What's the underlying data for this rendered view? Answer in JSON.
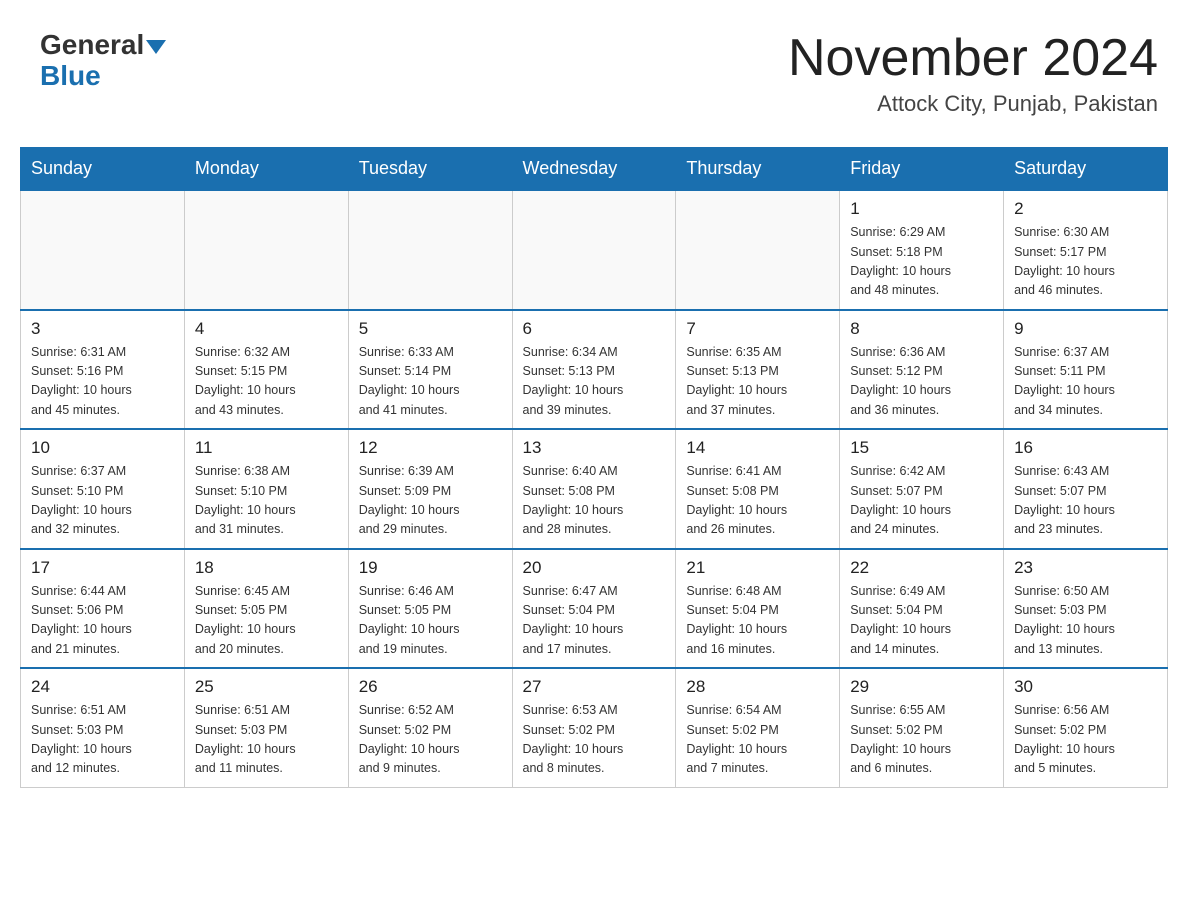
{
  "header": {
    "logo_line1": "General",
    "logo_line2": "Blue",
    "month_title": "November 2024",
    "location": "Attock City, Punjab, Pakistan"
  },
  "weekdays": [
    "Sunday",
    "Monday",
    "Tuesday",
    "Wednesday",
    "Thursday",
    "Friday",
    "Saturday"
  ],
  "weeks": [
    [
      {
        "day": "",
        "info": ""
      },
      {
        "day": "",
        "info": ""
      },
      {
        "day": "",
        "info": ""
      },
      {
        "day": "",
        "info": ""
      },
      {
        "day": "",
        "info": ""
      },
      {
        "day": "1",
        "info": "Sunrise: 6:29 AM\nSunset: 5:18 PM\nDaylight: 10 hours\nand 48 minutes."
      },
      {
        "day": "2",
        "info": "Sunrise: 6:30 AM\nSunset: 5:17 PM\nDaylight: 10 hours\nand 46 minutes."
      }
    ],
    [
      {
        "day": "3",
        "info": "Sunrise: 6:31 AM\nSunset: 5:16 PM\nDaylight: 10 hours\nand 45 minutes."
      },
      {
        "day": "4",
        "info": "Sunrise: 6:32 AM\nSunset: 5:15 PM\nDaylight: 10 hours\nand 43 minutes."
      },
      {
        "day": "5",
        "info": "Sunrise: 6:33 AM\nSunset: 5:14 PM\nDaylight: 10 hours\nand 41 minutes."
      },
      {
        "day": "6",
        "info": "Sunrise: 6:34 AM\nSunset: 5:13 PM\nDaylight: 10 hours\nand 39 minutes."
      },
      {
        "day": "7",
        "info": "Sunrise: 6:35 AM\nSunset: 5:13 PM\nDaylight: 10 hours\nand 37 minutes."
      },
      {
        "day": "8",
        "info": "Sunrise: 6:36 AM\nSunset: 5:12 PM\nDaylight: 10 hours\nand 36 minutes."
      },
      {
        "day": "9",
        "info": "Sunrise: 6:37 AM\nSunset: 5:11 PM\nDaylight: 10 hours\nand 34 minutes."
      }
    ],
    [
      {
        "day": "10",
        "info": "Sunrise: 6:37 AM\nSunset: 5:10 PM\nDaylight: 10 hours\nand 32 minutes."
      },
      {
        "day": "11",
        "info": "Sunrise: 6:38 AM\nSunset: 5:10 PM\nDaylight: 10 hours\nand 31 minutes."
      },
      {
        "day": "12",
        "info": "Sunrise: 6:39 AM\nSunset: 5:09 PM\nDaylight: 10 hours\nand 29 minutes."
      },
      {
        "day": "13",
        "info": "Sunrise: 6:40 AM\nSunset: 5:08 PM\nDaylight: 10 hours\nand 28 minutes."
      },
      {
        "day": "14",
        "info": "Sunrise: 6:41 AM\nSunset: 5:08 PM\nDaylight: 10 hours\nand 26 minutes."
      },
      {
        "day": "15",
        "info": "Sunrise: 6:42 AM\nSunset: 5:07 PM\nDaylight: 10 hours\nand 24 minutes."
      },
      {
        "day": "16",
        "info": "Sunrise: 6:43 AM\nSunset: 5:07 PM\nDaylight: 10 hours\nand 23 minutes."
      }
    ],
    [
      {
        "day": "17",
        "info": "Sunrise: 6:44 AM\nSunset: 5:06 PM\nDaylight: 10 hours\nand 21 minutes."
      },
      {
        "day": "18",
        "info": "Sunrise: 6:45 AM\nSunset: 5:05 PM\nDaylight: 10 hours\nand 20 minutes."
      },
      {
        "day": "19",
        "info": "Sunrise: 6:46 AM\nSunset: 5:05 PM\nDaylight: 10 hours\nand 19 minutes."
      },
      {
        "day": "20",
        "info": "Sunrise: 6:47 AM\nSunset: 5:04 PM\nDaylight: 10 hours\nand 17 minutes."
      },
      {
        "day": "21",
        "info": "Sunrise: 6:48 AM\nSunset: 5:04 PM\nDaylight: 10 hours\nand 16 minutes."
      },
      {
        "day": "22",
        "info": "Sunrise: 6:49 AM\nSunset: 5:04 PM\nDaylight: 10 hours\nand 14 minutes."
      },
      {
        "day": "23",
        "info": "Sunrise: 6:50 AM\nSunset: 5:03 PM\nDaylight: 10 hours\nand 13 minutes."
      }
    ],
    [
      {
        "day": "24",
        "info": "Sunrise: 6:51 AM\nSunset: 5:03 PM\nDaylight: 10 hours\nand 12 minutes."
      },
      {
        "day": "25",
        "info": "Sunrise: 6:51 AM\nSunset: 5:03 PM\nDaylight: 10 hours\nand 11 minutes."
      },
      {
        "day": "26",
        "info": "Sunrise: 6:52 AM\nSunset: 5:02 PM\nDaylight: 10 hours\nand 9 minutes."
      },
      {
        "day": "27",
        "info": "Sunrise: 6:53 AM\nSunset: 5:02 PM\nDaylight: 10 hours\nand 8 minutes."
      },
      {
        "day": "28",
        "info": "Sunrise: 6:54 AM\nSunset: 5:02 PM\nDaylight: 10 hours\nand 7 minutes."
      },
      {
        "day": "29",
        "info": "Sunrise: 6:55 AM\nSunset: 5:02 PM\nDaylight: 10 hours\nand 6 minutes."
      },
      {
        "day": "30",
        "info": "Sunrise: 6:56 AM\nSunset: 5:02 PM\nDaylight: 10 hours\nand 5 minutes."
      }
    ]
  ]
}
